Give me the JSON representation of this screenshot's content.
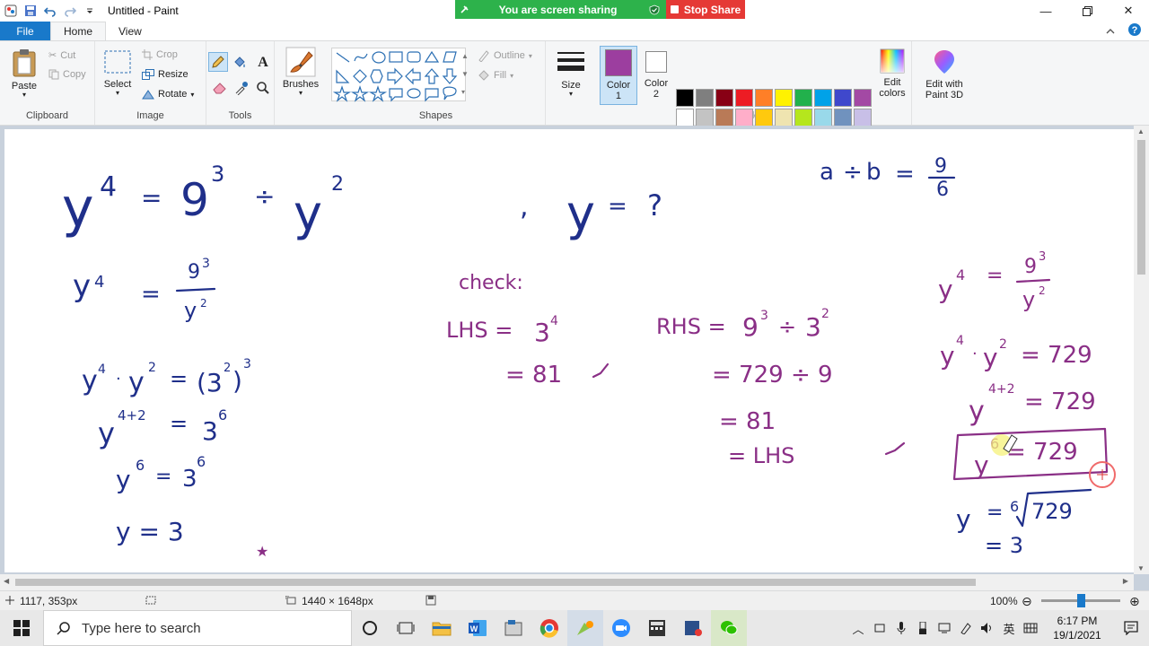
{
  "window": {
    "title": "Untitled - Paint",
    "share_notice": "You are screen sharing",
    "stop_share": "Stop Share"
  },
  "tabs": {
    "file": "File",
    "home": "Home",
    "view": "View"
  },
  "ribbon": {
    "clipboard": {
      "label": "Clipboard",
      "paste": "Paste",
      "cut": "Cut",
      "copy": "Copy"
    },
    "image": {
      "label": "Image",
      "select": "Select",
      "crop": "Crop",
      "resize": "Resize",
      "rotate": "Rotate"
    },
    "tools": {
      "label": "Tools"
    },
    "brushes": {
      "label": "Brushes"
    },
    "shapes": {
      "label": "Shapes",
      "outline": "Outline",
      "fill": "Fill"
    },
    "size": {
      "label": "Size"
    },
    "colors": {
      "label": "Colors",
      "color1": "Color\n1",
      "color1_line1": "Color",
      "color1_line2": "1",
      "color2_line1": "Color",
      "color2_line2": "2",
      "edit_colors_line1": "Edit",
      "edit_colors_line2": "colors",
      "paint3d_line1": "Edit with",
      "paint3d_line2": "Paint 3D",
      "color1_value": "#9c3e9f",
      "color2_value": "#ffffff",
      "palette_row1": [
        "#000000",
        "#7f7f7f",
        "#880015",
        "#ed1c24",
        "#ff7f27",
        "#fff200",
        "#22b14c",
        "#00a2e8",
        "#3f48cc",
        "#a349a4"
      ],
      "palette_row2": [
        "#ffffff",
        "#c3c3c3",
        "#b97a57",
        "#ffaec9",
        "#ffc90e",
        "#efe4b0",
        "#b5e61d",
        "#99d9ea",
        "#7092be",
        "#c8bfe7"
      ],
      "palette_row3": [
        "#ffffff",
        "#ffffff",
        "#ffffff",
        "#ffffff",
        "#ffffff",
        "#ffffff",
        "#ffffff",
        "#ffffff",
        "#ffffff",
        "#ffffff"
      ]
    }
  },
  "handwriting": {
    "eq_main": {
      "y": "y",
      "e4": "4",
      "eq": "=",
      "nine": "9",
      "e3": "3",
      "div": "÷",
      "y2": "y",
      "e2": "2"
    },
    "eq_q": {
      "comma": ",",
      "y": "y",
      "eq": "=",
      "q": "?"
    },
    "ratio": {
      "a": "a",
      "div": "÷",
      "b": "b",
      "eq": "=",
      "num": "9",
      "den": "6"
    },
    "left": {
      "l1_y": "y",
      "l1_e": "4",
      "l1_eq": "=",
      "l1_num": "9",
      "l1_num_e": "3",
      "l1_den": "y",
      "l1_den_e": "2",
      "l2_lhs": "y",
      "l2_e1": "4",
      "l2_dot": "·",
      "l2_y": "y",
      "l2_e2": "2",
      "l2_eq": "=",
      "l2_rhs": "(3",
      "l2_rhs_e": "2",
      "l2_close": ")",
      "l2_out_e": "3",
      "l3_y": "y",
      "l3_e": "4+2",
      "l3_eq": "=",
      "l3_3": "3",
      "l3_3e": "6",
      "l4_y": "y",
      "l4_e": "6",
      "l4_eq": "=",
      "l4_3": "3",
      "l4_3e": "6",
      "l5": "y = 3",
      "mark": "★"
    },
    "check": {
      "title": "check:",
      "lhs_label": "LHS =",
      "lhs_base": "3",
      "lhs_exp": "4",
      "lhs_val": "= 81",
      "rhs_label": "RHS =",
      "rhs_a": "9",
      "rhs_ae": "3",
      "rhs_div": "÷",
      "rhs_b": "3",
      "rhs_be": "2",
      "rhs_l2": "= 729 ÷ 9",
      "rhs_l3": "= 81",
      "rhs_l4": "= LHS"
    },
    "right": {
      "r1_y": "y",
      "r1_e": "4",
      "r1_eq": "=",
      "r1_num": "9",
      "r1_num_e": "3",
      "r1_den": "y",
      "r1_den_e": "2",
      "r2_y": "y",
      "r2_e1": "4",
      "r2_dot": "·",
      "r2_y2": "y",
      "r2_e2": "2",
      "r2_rhs": "= 729",
      "r3_y": "y",
      "r3_e": "4+2",
      "r3_rhs": "= 729",
      "r4_y": "y",
      "r4_e": "6",
      "r4_rhs": "= 729",
      "r5_y": "y",
      "r5_eq": "=",
      "r5_idx": "6",
      "r5_rad": "729",
      "r6": "= 3"
    }
  },
  "status": {
    "cursor": "1117, 353px",
    "canvas_size": "1440 × 1648px",
    "zoom": "100%",
    "zoom_fraction": 0.5
  },
  "taskbar": {
    "search_placeholder": "Type here to search",
    "time": "6:17 PM",
    "date": "19/1/2021",
    "ime": "英"
  }
}
